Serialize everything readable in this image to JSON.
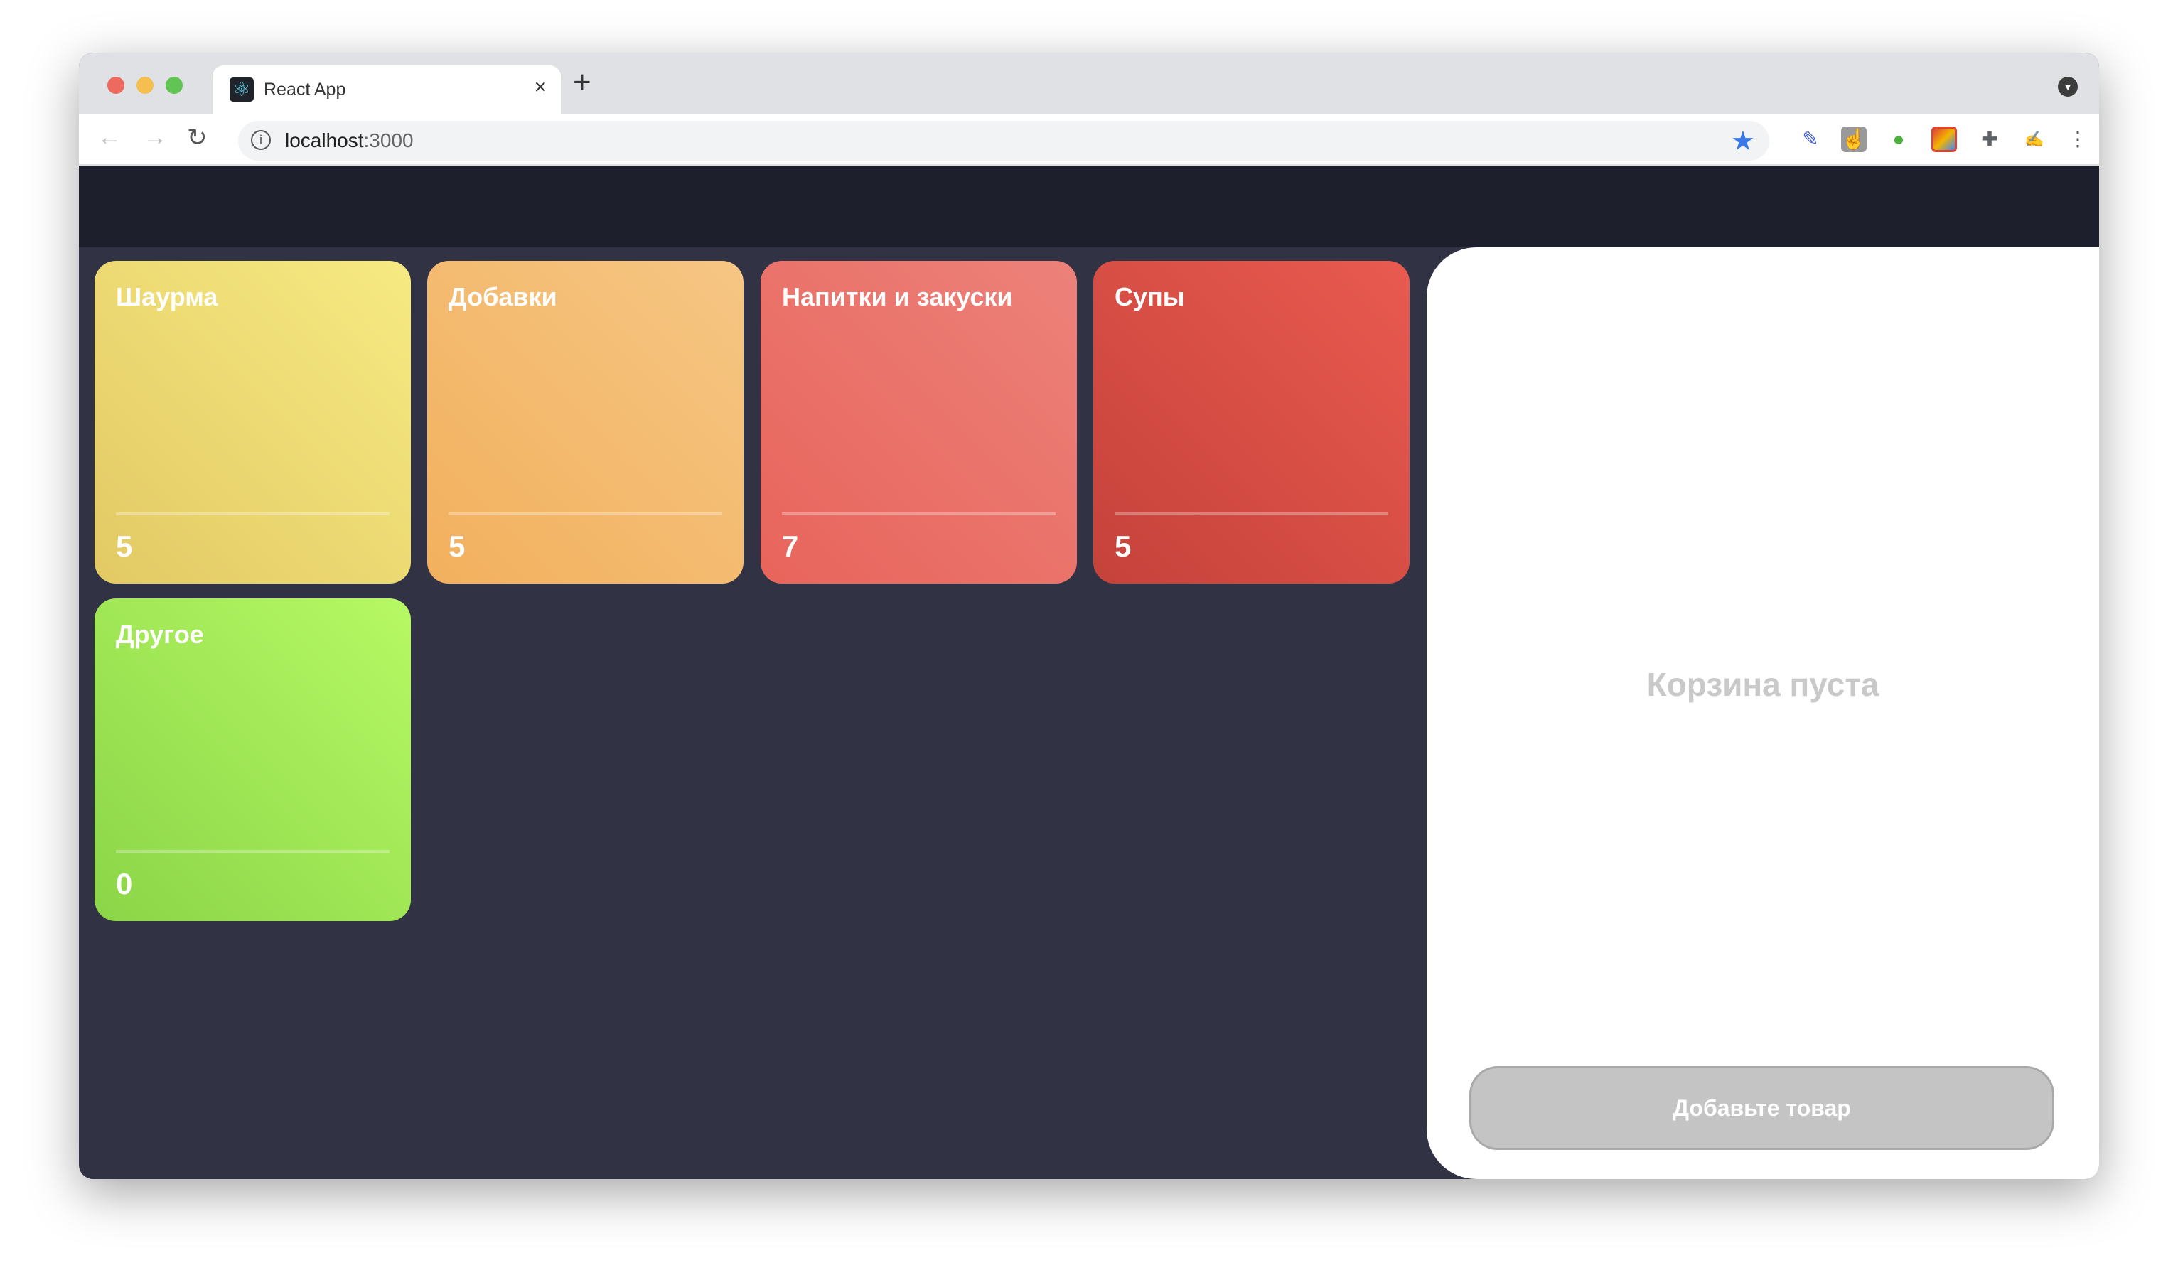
{
  "browser": {
    "tab_title": "React App",
    "url_host": "localhost",
    "url_port": ":3000",
    "new_tab": "+",
    "close": "×",
    "icons": [
      "back-arrow",
      "forward-arrow",
      "reload",
      "info",
      "bookmark-star",
      "eyedropper-extension",
      "touch-extension",
      "evernote-extension",
      "slides-extension",
      "puzzle-extensions",
      "signature-extension",
      "kebab-menu",
      "profile-dropdown"
    ]
  },
  "categories": [
    {
      "name": "Шаурма",
      "count": "5",
      "colors": [
        "#f7ea82",
        "#e2c964"
      ]
    },
    {
      "name": "Добавки",
      "count": "5",
      "colors": [
        "#f6c684",
        "#f2b05d"
      ]
    },
    {
      "name": "Напитки и закуски",
      "count": "7",
      "colors": [
        "#ec827a",
        "#e8645b"
      ]
    },
    {
      "name": "Супы",
      "count": "5",
      "colors": [
        "#e95a50",
        "#c5423a"
      ]
    },
    {
      "name": "Другое",
      "count": "0",
      "colors": [
        "#b6f964",
        "#8bd548"
      ]
    }
  ],
  "cart": {
    "empty_text": "Корзина пуста",
    "button_label": "Добавьте товар"
  }
}
